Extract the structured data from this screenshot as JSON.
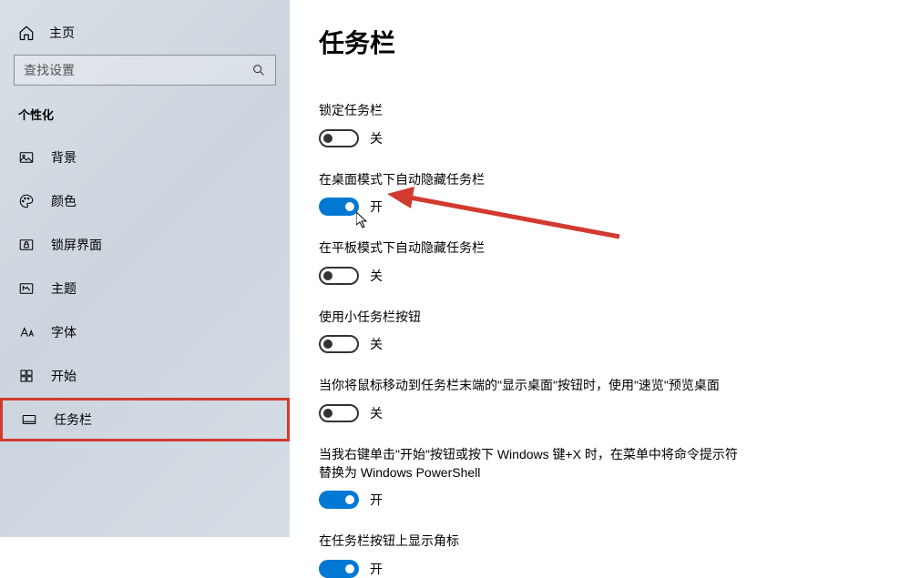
{
  "sidebar": {
    "home_label": "主页",
    "search_placeholder": "查找设置",
    "section_label": "个性化",
    "items": [
      {
        "label": "背景"
      },
      {
        "label": "颜色"
      },
      {
        "label": "锁屏界面"
      },
      {
        "label": "主题"
      },
      {
        "label": "字体"
      },
      {
        "label": "开始"
      },
      {
        "label": "任务栏"
      }
    ]
  },
  "page": {
    "title": "任务栏",
    "state_on": "开",
    "state_off": "关",
    "settings": [
      {
        "label": "锁定任务栏",
        "on": false
      },
      {
        "label": "在桌面模式下自动隐藏任务栏",
        "on": true
      },
      {
        "label": "在平板模式下自动隐藏任务栏",
        "on": false
      },
      {
        "label": "使用小任务栏按钮",
        "on": false
      },
      {
        "label": "当你将鼠标移动到任务栏末端的\"显示桌面\"按钮时，使用\"速览\"预览桌面",
        "on": false
      },
      {
        "label": "当我右键单击\"开始\"按钮或按下 Windows 键+X 时，在菜单中将命令提示符替换为 Windows PowerShell",
        "on": true
      },
      {
        "label": "在任务栏按钮上显示角标",
        "on": true
      }
    ]
  }
}
